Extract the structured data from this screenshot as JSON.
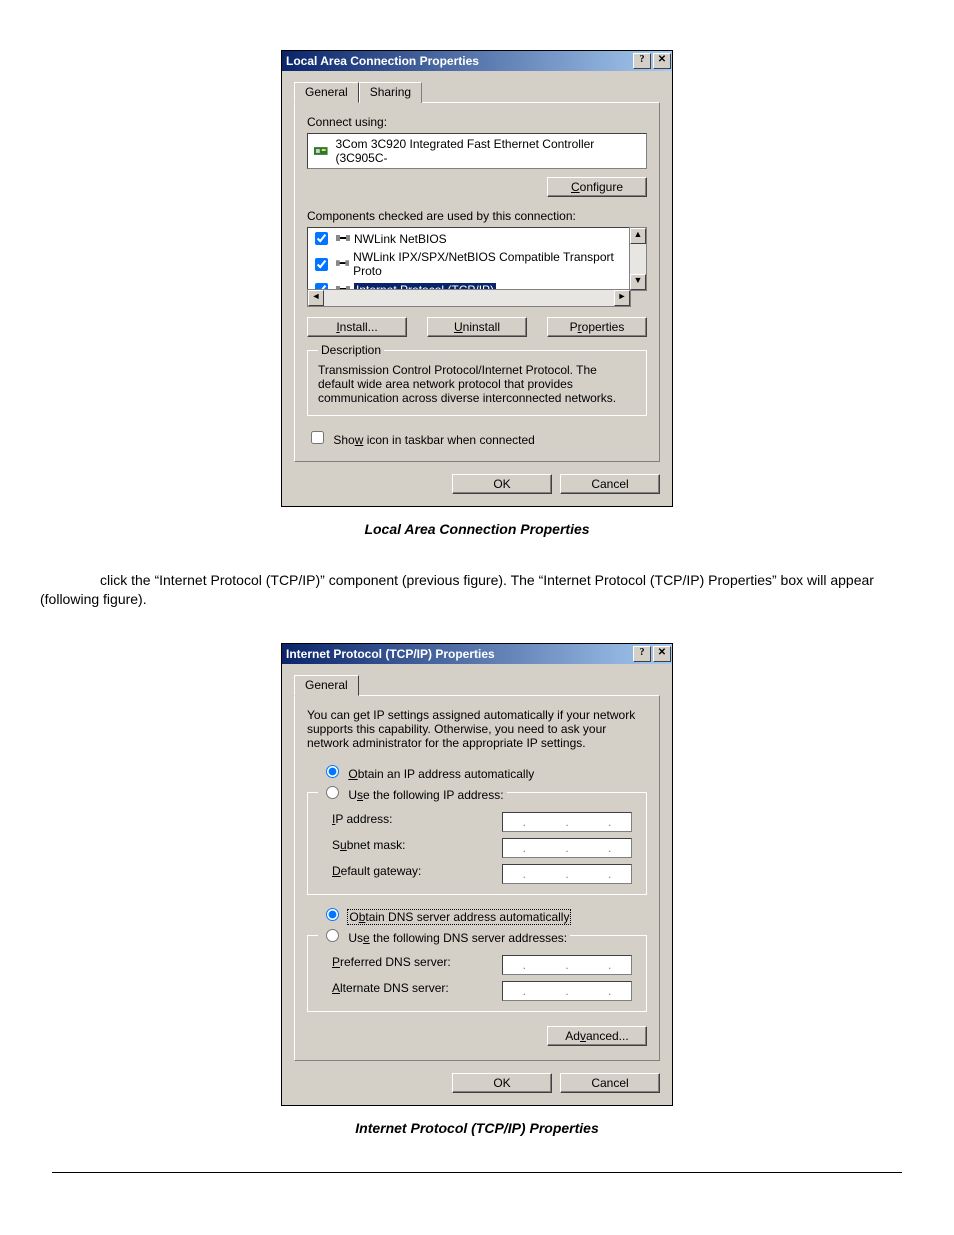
{
  "dlg1": {
    "title": "Local Area Connection Properties",
    "tabs": {
      "general": "General",
      "sharing": "Sharing"
    },
    "connect_using_label": "Connect using:",
    "adapter": "3Com 3C920 Integrated Fast Ethernet Controller (3C905C-",
    "configure_btn": "Configure",
    "components_label": "Components checked are used by this connection:",
    "components": {
      "a": "NWLink NetBIOS",
      "b": "NWLink IPX/SPX/NetBIOS Compatible Transport Proto",
      "c": "Internet Protocol (TCP/IP)"
    },
    "install_btn": "Install...",
    "uninstall_btn": "Uninstall",
    "properties_btn": "Properties",
    "description_legend": "Description",
    "description_text": "Transmission Control Protocol/Internet Protocol. The default wide area network protocol that provides communication across diverse interconnected networks.",
    "show_icon_label": "Show icon in taskbar when connected",
    "ok": "OK",
    "cancel": "Cancel"
  },
  "caption1": "Local Area Connection Properties",
  "body_text": "click the “Internet Protocol (TCP/IP)” component (previous figure). The “Internet Protocol (TCP/IP) Properties” box will appear (following figure).",
  "dlg2": {
    "title": "Internet Protocol (TCP/IP) Properties",
    "tab_general": "General",
    "intro": "You can get IP settings assigned automatically if your network supports this capability. Otherwise, you need to ask your network administrator for the appropriate IP settings.",
    "opt_ip_auto": "Obtain an IP address automatically",
    "opt_ip_manual": "Use the following IP address:",
    "ip_address_label": "IP address:",
    "subnet_label": "Subnet mask:",
    "gateway_label": "Default gateway:",
    "opt_dns_auto": "Obtain DNS server address automatically",
    "opt_dns_manual": "Use the following DNS server addresses:",
    "pref_dns_label": "Preferred DNS server:",
    "alt_dns_label": "Alternate DNS server:",
    "advanced_btn": "Advanced...",
    "ok": "OK",
    "cancel": "Cancel"
  },
  "caption2": "Internet Protocol (TCP/IP) Properties"
}
